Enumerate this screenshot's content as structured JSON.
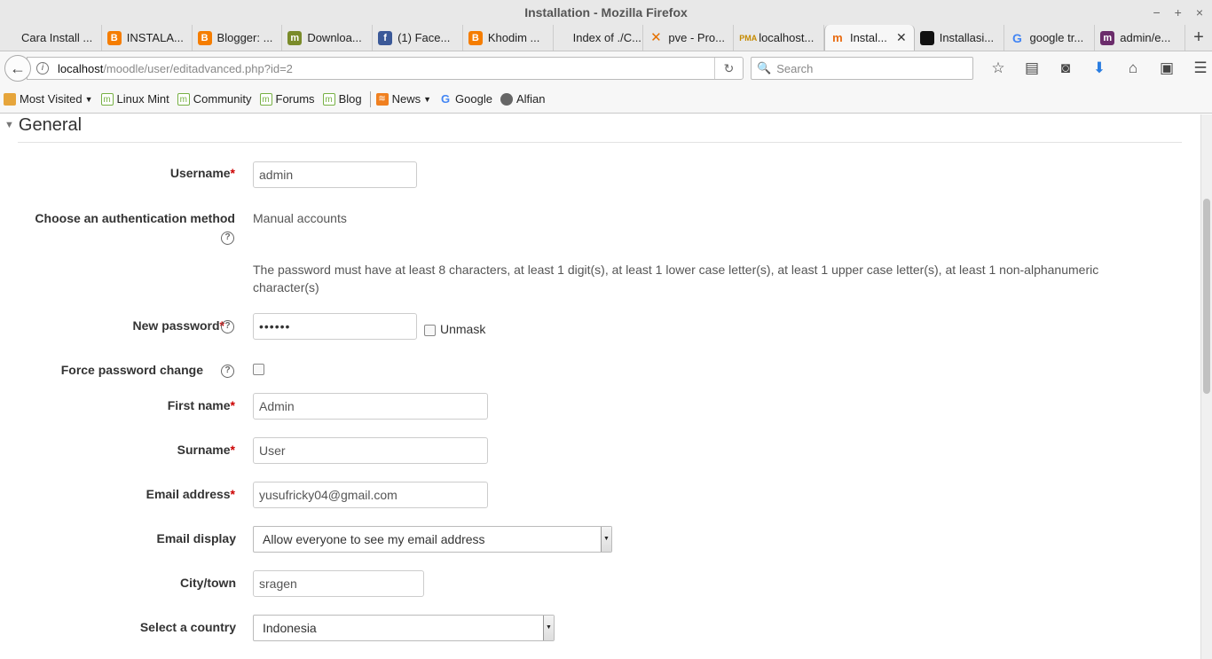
{
  "window": {
    "title": "Installation - Mozilla Firefox",
    "minimize": "−",
    "maximize": "+",
    "close": "×"
  },
  "tabs": [
    {
      "label": "Cara Install ...",
      "icon": "none"
    },
    {
      "label": "INSTALA...",
      "icon": "blogger-icon"
    },
    {
      "label": "Blogger: ...",
      "icon": "blogger-icon"
    },
    {
      "label": "Downloa...",
      "icon": "moodle-icon"
    },
    {
      "label": "(1) Face...",
      "icon": "facebook-icon"
    },
    {
      "label": "Khodim ...",
      "icon": "blogger-icon"
    },
    {
      "label": "Index of ./C...",
      "icon": "none"
    },
    {
      "label": "pve - Pro...",
      "icon": "proxmox-icon"
    },
    {
      "label": "localhost...",
      "icon": "phpmyadmin-icon"
    },
    {
      "label": "Instal...",
      "icon": "moodle-m-icon",
      "active": true
    },
    {
      "label": "Installasi...",
      "icon": "terminal-icon"
    },
    {
      "label": "google tr...",
      "icon": "google-icon"
    },
    {
      "label": "admin/e...",
      "icon": "moodle-icon"
    }
  ],
  "new_tab": "+",
  "url": {
    "host": "localhost",
    "path": "/moodle/user/editadvanced.php?id=2"
  },
  "search": {
    "placeholder": "Search"
  },
  "bookmarks": {
    "most_visited": "Most Visited",
    "linux_mint": "Linux Mint",
    "community": "Community",
    "forums": "Forums",
    "blog": "Blog",
    "news": "News",
    "google": "Google",
    "alfian": "Alfian"
  },
  "form": {
    "section_title": "General",
    "username": {
      "label": "Username",
      "value": "admin"
    },
    "auth": {
      "label": "Choose an authentication method",
      "value": "Manual accounts"
    },
    "password_rule": "The password must have at least 8 characters, at least 1 digit(s), at least 1 lower case letter(s), at least 1 upper case letter(s), at least 1 non-alphanumeric character(s)",
    "new_password": {
      "label": "New password",
      "value": "••••••",
      "unmask": "Unmask"
    },
    "force_change": {
      "label": "Force password change"
    },
    "first_name": {
      "label": "First name",
      "value": "Admin"
    },
    "surname": {
      "label": "Surname",
      "value": "User"
    },
    "email": {
      "label": "Email address",
      "value": "yusufricky04@gmail.com"
    },
    "email_display": {
      "label": "Email display",
      "value": "Allow everyone to see my email address"
    },
    "city": {
      "label": "City/town",
      "value": "sragen"
    },
    "country": {
      "label": "Select a country",
      "value": "Indonesia"
    },
    "required_mark": "*"
  }
}
